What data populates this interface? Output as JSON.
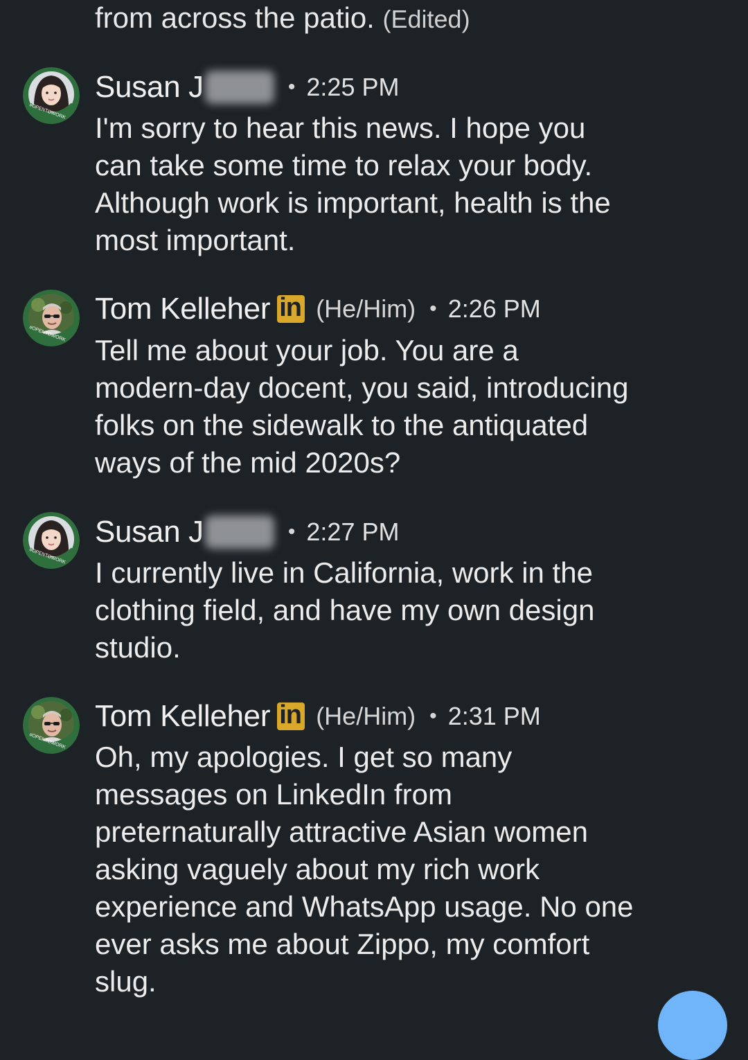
{
  "conversation": {
    "top_fragment": {
      "text": "from across the patio.",
      "edited_label": "(Edited)"
    },
    "messages": [
      {
        "sender": "Susan J",
        "sender_badge": "",
        "pronouns": "",
        "time": "2:25 PM",
        "avatar_ring_text": "#OPENTOWORK",
        "lines": [
          "I'm sorry to hear this news. I hope you",
          "can take some time to relax your body.",
          "Although work is important, health is the",
          "most important."
        ]
      },
      {
        "sender": "Tom Kelleher",
        "sender_badge": "in",
        "pronouns": "(He/Him)",
        "time": "2:26 PM",
        "avatar_ring_text": "#OPENTOWORK",
        "lines": [
          "Tell me about your job.  You are a",
          "modern-day docent, you said,  introducing",
          "folks on the sidewalk to the antiquated",
          "ways of the mid 2020s?"
        ]
      },
      {
        "sender": "Susan J",
        "sender_badge": "",
        "pronouns": "",
        "time": "2:27 PM",
        "avatar_ring_text": "#OPENTOWORK",
        "lines": [
          "I currently live in California, work in the",
          "clothing field, and have my own design",
          "studio."
        ]
      },
      {
        "sender": "Tom Kelleher",
        "sender_badge": "in",
        "pronouns": "(He/Him)",
        "time": "2:31 PM",
        "avatar_ring_text": "#OPENTOWORK",
        "lines": [
          "Oh, my apologies.  I get so many",
          "messages on LinkedIn from",
          "preternaturally attractive Asian women",
          "asking vaguely about my rich work",
          "experience and WhatsApp usage.  No one",
          "ever asks me about Zippo, my comfort",
          "slug."
        ]
      }
    ]
  },
  "colors": {
    "background": "#1d2226",
    "text": "#e9e9e9",
    "open_to_work_green": "#2f6f3e",
    "linkedin_badge": "#d9a72a",
    "fab": "#70b5f9"
  }
}
